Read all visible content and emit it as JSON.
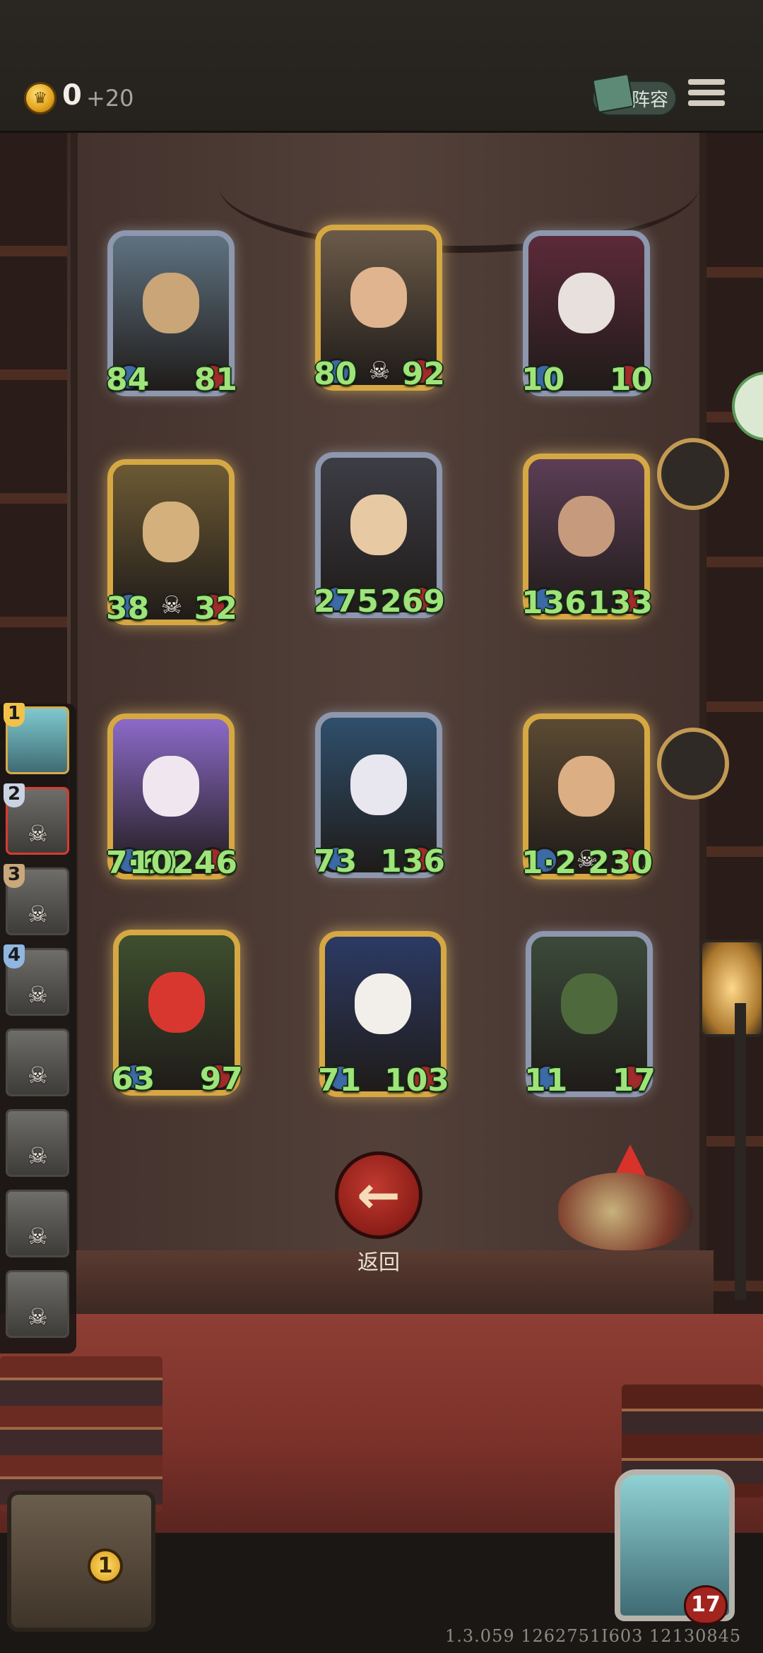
{
  "topbar": {
    "coins": "0",
    "coin_bonus": "+20",
    "lineup_label": "阵容"
  },
  "board": {
    "cards": [
      {
        "id": "knight",
        "tier": "silver",
        "attack": "84",
        "health": "81",
        "skull": false
      },
      {
        "id": "blacksmith",
        "tier": "gold",
        "attack": "80",
        "health": "92",
        "skull": true
      },
      {
        "id": "jester-puppet",
        "tier": "silver",
        "attack": "10",
        "health": "10",
        "skull": false
      },
      {
        "id": "ogre-noble",
        "tier": "gold",
        "attack": "38",
        "health": "32",
        "skull": true
      },
      {
        "id": "valkyrie",
        "tier": "silver",
        "attack": "275",
        "health": "269",
        "skull": false
      },
      {
        "id": "brute",
        "tier": "gold",
        "attack": "136",
        "health": "133",
        "skull": false
      },
      {
        "id": "dark-lady",
        "tier": "gold",
        "attack": "7·61",
        "health": "10246",
        "skull": false
      },
      {
        "id": "blue-imp",
        "tier": "silver",
        "attack": "73",
        "health": "136",
        "skull": false
      },
      {
        "id": "pinocchio",
        "tier": "gold",
        "attack": "1·2",
        "health": "230",
        "skull": true
      },
      {
        "id": "red-devil",
        "tier": "gold",
        "attack": "63",
        "health": "97",
        "skull": false
      },
      {
        "id": "clown",
        "tier": "gold",
        "attack": "71",
        "health": "103",
        "skull": false
      },
      {
        "id": "goblin",
        "tier": "silver",
        "attack": "11",
        "health": "17",
        "skull": false
      }
    ]
  },
  "roster": {
    "slots": [
      {
        "rank": "1",
        "state": "active"
      },
      {
        "rank": "2",
        "state": "selected"
      },
      {
        "rank": "3",
        "state": "defeated"
      },
      {
        "rank": "4",
        "state": "defeated"
      },
      {
        "rank": "",
        "state": "defeated"
      },
      {
        "rank": "",
        "state": "defeated"
      },
      {
        "rank": "",
        "state": "defeated"
      },
      {
        "rank": "",
        "state": "defeated"
      }
    ]
  },
  "back_button": {
    "label": "返回"
  },
  "chest": {
    "count": "1"
  },
  "hero": {
    "health": "17"
  },
  "footer": {
    "version": "1.3.059 1262751I603 12130845"
  },
  "colors": {
    "stat_green": "#9fe37a",
    "gold_frame": "#d6a843",
    "silver_frame": "#8d97ad",
    "back_red": "#a2241f"
  }
}
